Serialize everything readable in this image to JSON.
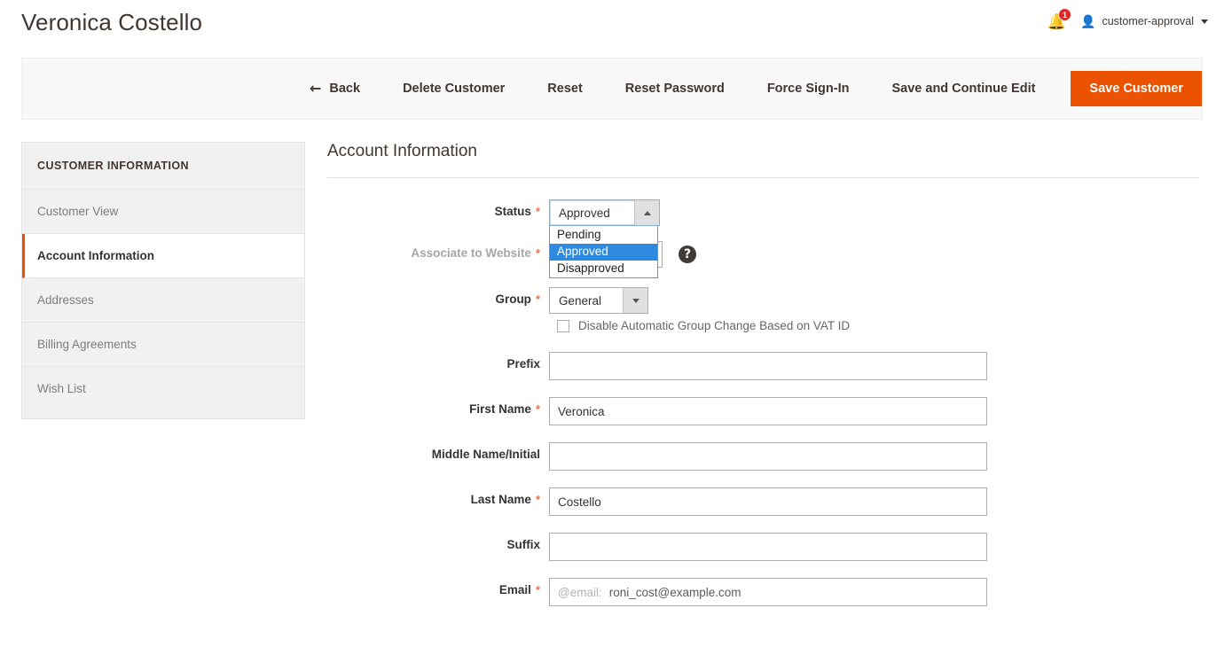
{
  "header": {
    "title": "Veronica Costello",
    "notifications": {
      "icon": "bell-icon",
      "count": "1"
    },
    "user": {
      "avatar_icon": "user-avatar-icon",
      "name": "customer-approval",
      "caret_icon": "chevron-down-icon"
    }
  },
  "toolbar": {
    "back_icon": "arrow-left-icon",
    "back": "Back",
    "delete_customer": "Delete Customer",
    "reset": "Reset",
    "reset_password": "Reset Password",
    "force_sign_in": "Force Sign-In",
    "save_and_continue": "Save and Continue Edit",
    "save_customer": "Save Customer",
    "primary_color": "#eb5202"
  },
  "sidebar": {
    "title": "CUSTOMER INFORMATION",
    "items": [
      {
        "label": "Customer View",
        "active": false
      },
      {
        "label": "Account Information",
        "active": true
      },
      {
        "label": "Addresses",
        "active": false
      },
      {
        "label": "Billing Agreements",
        "active": false
      },
      {
        "label": "Wish List",
        "active": false
      }
    ],
    "active_accent": "#eb5202"
  },
  "main": {
    "section_title": "Account Information",
    "required_marker": "*",
    "fields": {
      "status": {
        "label": "Status",
        "required": true,
        "value": "Approved",
        "open": true,
        "arrow_icon": "caret-up-icon",
        "options": [
          "Pending",
          "Approved",
          "Disapproved"
        ],
        "selected_option": "Approved",
        "highlight_color": "#2d8ae0"
      },
      "website": {
        "label": "Associate to Website",
        "required": true,
        "help_icon": "question-mark-icon"
      },
      "group": {
        "label": "Group",
        "required": true,
        "value": "General",
        "arrow_icon": "caret-down-icon"
      },
      "disable_vat": {
        "label": "Disable Automatic Group Change Based on VAT ID",
        "checked": false
      },
      "prefix": {
        "label": "Prefix",
        "required": false,
        "value": ""
      },
      "first_name": {
        "label": "First Name",
        "required": true,
        "value": "Veronica"
      },
      "middle_name": {
        "label": "Middle Name/Initial",
        "required": false,
        "value": ""
      },
      "last_name": {
        "label": "Last Name",
        "required": true,
        "value": "Costello"
      },
      "suffix": {
        "label": "Suffix",
        "required": false,
        "value": ""
      },
      "email": {
        "label": "Email",
        "required": true,
        "prefix": "@email:",
        "value": "roni_cost@example.com"
      }
    }
  }
}
